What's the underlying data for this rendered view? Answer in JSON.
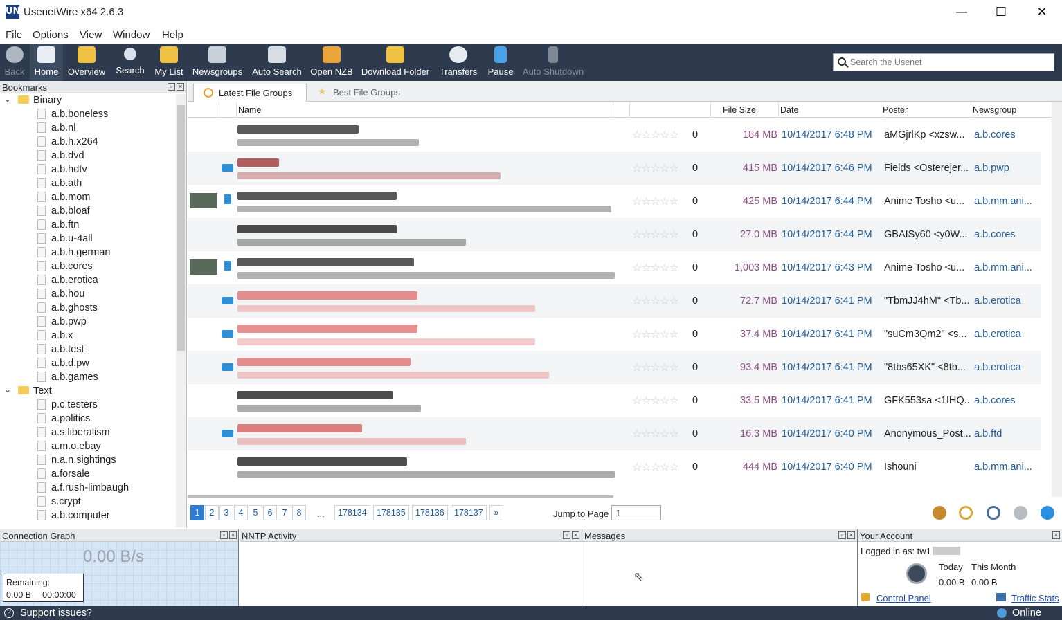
{
  "window": {
    "title": "UsenetWire x64 2.6.3",
    "logo": "UN",
    "minimize": "—",
    "maximize": "☐",
    "close": "✕"
  },
  "menu": [
    "File",
    "Options",
    "View",
    "Window",
    "Help"
  ],
  "toolbar": [
    {
      "label": "Back",
      "icon": "back-arrow-icon",
      "disabled": true,
      "color": "#aeb6c2"
    },
    {
      "label": "Home",
      "icon": "home-icon",
      "disabled": false,
      "color": "#e9eef5"
    },
    {
      "label": "Overview",
      "icon": "overview-icon",
      "disabled": false,
      "color": "#f0c243"
    },
    {
      "label": "Search",
      "icon": "search-icon",
      "disabled": false,
      "color": "#d9e2ec"
    },
    {
      "label": "My List",
      "icon": "my-list-icon",
      "disabled": false,
      "color": "#f0c243"
    },
    {
      "label": "Newsgroups",
      "icon": "newsgroups-icon",
      "disabled": false,
      "color": "#c8d0da"
    },
    {
      "label": "Auto Search",
      "icon": "auto-search-icon",
      "disabled": false,
      "color": "#d8dde4"
    },
    {
      "label": "Open NZB",
      "icon": "open-nzb-icon",
      "disabled": false,
      "color": "#e9a53b"
    },
    {
      "label": "Download Folder",
      "icon": "download-folder-icon",
      "disabled": false,
      "color": "#f0c243"
    },
    {
      "label": "Transfers",
      "icon": "transfers-icon",
      "disabled": false,
      "color": "#e6ebf1"
    },
    {
      "label": "Pause",
      "icon": "pause-icon",
      "disabled": false,
      "color": "#4aa3e8"
    },
    {
      "label": "Auto Shutdown",
      "icon": "auto-shutdown-icon",
      "disabled": true,
      "color": "#7f8894"
    }
  ],
  "search": {
    "placeholder": "Search the Usenet"
  },
  "bookmarks": {
    "title": "Bookmarks",
    "binary_label": "Binary",
    "binary": [
      "a.b.boneless",
      "a.b.nl",
      "a.b.h.x264",
      "a.b.dvd",
      "a.b.hdtv",
      "a.b.ath",
      "a.b.mom",
      "a.b.bloaf",
      "a.b.ftn",
      "a.b.u-4all",
      "a.b.h.german",
      "a.b.cores",
      "a.b.erotica",
      "a.b.hou",
      "a.b.ghosts",
      "a.b.pwp",
      "a.b.x",
      "a.b.test",
      "a.b.d.pw",
      "a.b.games"
    ],
    "text_label": "Text",
    "text": [
      "p.c.testers",
      "a.politics",
      "a.s.liberalism",
      "a.m.o.ebay",
      "n.a.n.sightings",
      "a.forsale",
      "a.f.rush-limbaugh",
      "s.crypt",
      "a.b.computer"
    ]
  },
  "tabs": {
    "latest": "Latest File Groups",
    "best": "Best File Groups"
  },
  "columns": {
    "name": "Name",
    "size": "File Size",
    "date": "Date",
    "poster": "Poster",
    "group": "Newsgroup"
  },
  "rows": [
    {
      "votes": "0",
      "size": "184 MB",
      "date": "10/14/2017 6:48 PM",
      "poster": "aMGjrlKp <xzsw...",
      "group": "a.b.cores",
      "icon": "none",
      "tone": "#222"
    },
    {
      "votes": "0",
      "size": "415 MB",
      "date": "10/14/2017 6:46 PM",
      "poster": "Fields <Osterejer...",
      "group": "a.b.pwp",
      "icon": "nzb",
      "tone": "#9b2a2a"
    },
    {
      "votes": "0",
      "size": "425 MB",
      "date": "10/14/2017 6:44 PM",
      "poster": "Anime Tosho <u...",
      "group": "a.b.mm.ani...",
      "icon": "pic",
      "tone": "#222"
    },
    {
      "votes": "0",
      "size": "27.0 MB",
      "date": "10/14/2017 6:44 PM",
      "poster": "GBAISy60 <y0W...",
      "group": "a.b.cores",
      "icon": "none",
      "tone": "#111"
    },
    {
      "votes": "0",
      "size": "1,003 MB",
      "date": "10/14/2017 6:43 PM",
      "poster": "Anime Tosho <u...",
      "group": "a.b.mm.ani...",
      "icon": "pic",
      "tone": "#222"
    },
    {
      "votes": "0",
      "size": "72.7 MB",
      "date": "10/14/2017 6:41 PM",
      "poster": "\"TbmJJ4hM\" <Tb...",
      "group": "a.b.erotica",
      "icon": "nzb",
      "tone": "#e06a6a"
    },
    {
      "votes": "0",
      "size": "37.4 MB",
      "date": "10/14/2017 6:41 PM",
      "poster": "\"suCm3Qm2\" <s...",
      "group": "a.b.erotica",
      "icon": "nzb",
      "tone": "#e06a6a"
    },
    {
      "votes": "0",
      "size": "93.4 MB",
      "date": "10/14/2017 6:41 PM",
      "poster": "\"8tbs65XK\" <8tb...",
      "group": "a.b.erotica",
      "icon": "nzb",
      "tone": "#e06a6a"
    },
    {
      "votes": "0",
      "size": "33.5 MB",
      "date": "10/14/2017 6:41 PM",
      "poster": "GFK553sa <1IHQ...",
      "group": "a.b.cores",
      "icon": "none",
      "tone": "#111"
    },
    {
      "votes": "0",
      "size": "16.3 MB",
      "date": "10/14/2017 6:40 PM",
      "poster": "Anonymous_Post...",
      "group": "a.b.ftd",
      "icon": "nzb",
      "tone": "#d45555"
    },
    {
      "votes": "0",
      "size": "444 MB",
      "date": "10/14/2017 6:40 PM",
      "poster": "Ishouni",
      "group": "a.b.mm.ani...",
      "icon": "none",
      "tone": "#111"
    }
  ],
  "pager": {
    "pages": [
      "1",
      "2",
      "3",
      "4",
      "5",
      "6",
      "7",
      "8"
    ],
    "ellipsis": "...",
    "last_pages": [
      "178134",
      "178135",
      "178136",
      "178137"
    ],
    "next": "»",
    "jump_label": "Jump to Page",
    "jump_value": "1"
  },
  "panels": {
    "graph_title": "Connection Graph",
    "speed": "0.00 B/s",
    "remaining_label": "Remaining:",
    "remaining_bytes": "0.00 B",
    "remaining_time": "00:00:00",
    "nntp_title": "NNTP Activity",
    "messages_title": "Messages",
    "account_title": "Your Account",
    "logged_in": "Logged in as: tw1",
    "today_label": "Today",
    "month_label": "This Month",
    "today_value": "0.00 B",
    "month_value": "0.00 B",
    "control_panel": "Control Panel",
    "traffic_stats": "Traffic Stats"
  },
  "status": {
    "support": "Support issues?",
    "online": "Online"
  }
}
